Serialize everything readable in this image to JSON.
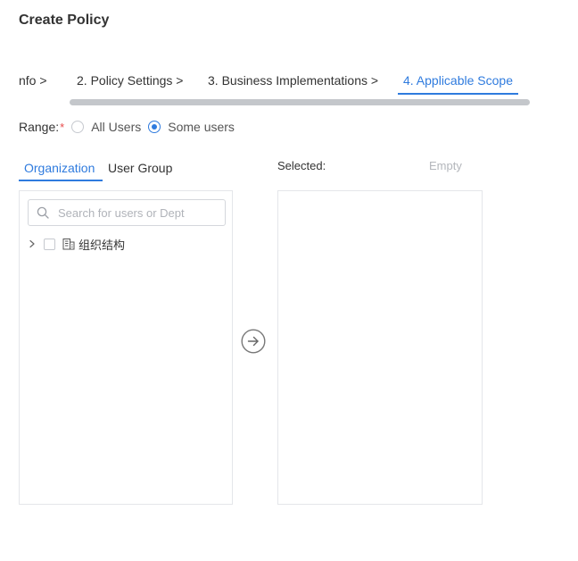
{
  "dialog": {
    "title": "Create Policy"
  },
  "steps": [
    {
      "label": "nfo >"
    },
    {
      "label": "2. Policy Settings >"
    },
    {
      "label": "3. Business Implementations >"
    },
    {
      "label": "4. Applicable Scope"
    }
  ],
  "range": {
    "label": "Range:",
    "required_mark": "*",
    "options": [
      {
        "label": "All Users",
        "checked": false
      },
      {
        "label": "Some users",
        "checked": true
      }
    ]
  },
  "tabs": [
    {
      "label": "Organization",
      "active": true
    },
    {
      "label": "User Group",
      "active": false
    }
  ],
  "search": {
    "placeholder": "Search for users or Dept",
    "value": ""
  },
  "tree": {
    "root_label": "组织结构",
    "expanded": false,
    "checked": false
  },
  "selected": {
    "label": "Selected:",
    "empty_text": "Empty"
  },
  "colors": {
    "accent": "#2f7bde",
    "required": "#e84a4a",
    "border": "#e4e6ea",
    "muted": "#b3b6bb"
  },
  "icons": [
    "search-icon",
    "chevron-right-icon",
    "building-icon",
    "arrow-right-circle-icon"
  ]
}
